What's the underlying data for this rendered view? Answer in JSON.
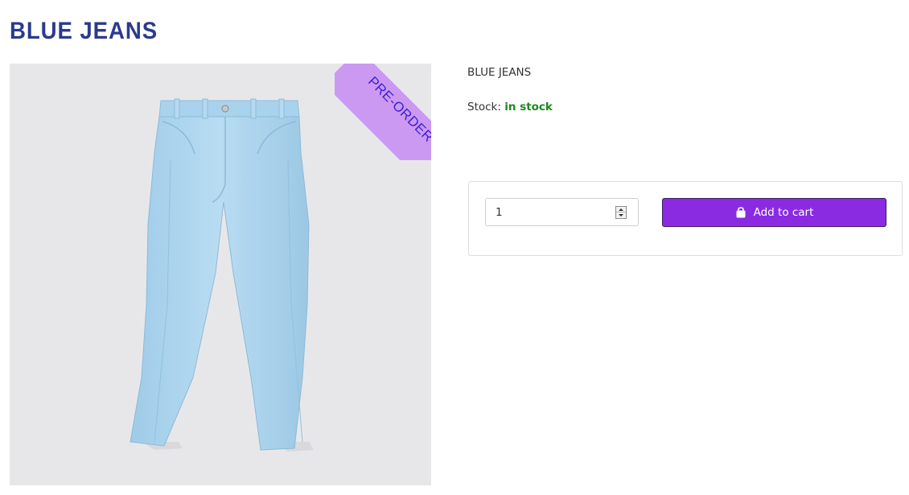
{
  "page": {
    "title": "BLUE JEANS",
    "title_color": "#2b3a8c"
  },
  "product": {
    "name": "BLUE JEANS",
    "badge": "PRE-ORDER",
    "badge_bg": "#cc99f2",
    "badge_text_color": "#3a1fd6",
    "image_icon": "jeans-image",
    "stock_label": "Stock:",
    "stock_status": "in stock",
    "stock_color": "#1a8a1a"
  },
  "cart": {
    "quantity": "1",
    "add_label": "Add to cart",
    "add_icon": "shopping-bag-icon",
    "button_color": "#8a2be2"
  }
}
